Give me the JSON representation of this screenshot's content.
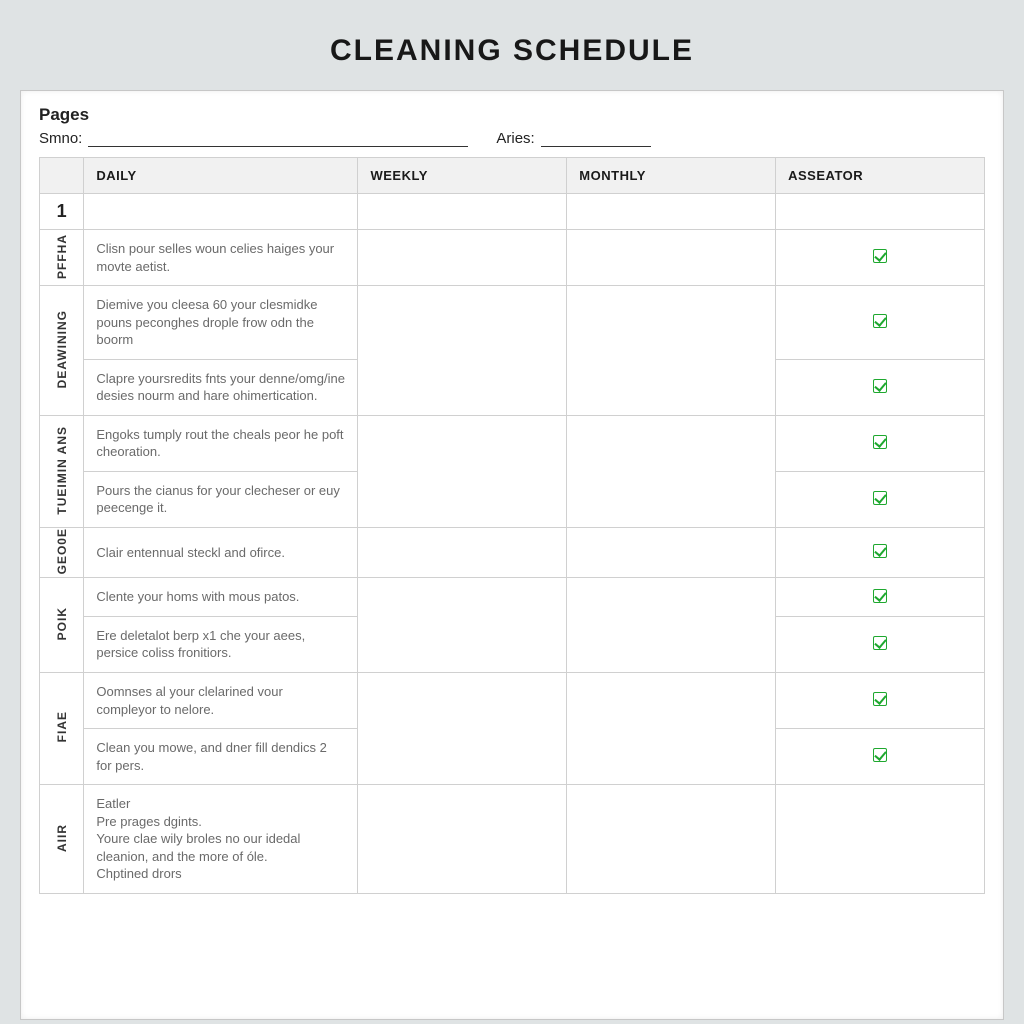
{
  "title": "CLEANING SCHEDULE",
  "header": {
    "pages_label": "Pages",
    "field1_label": "Smno:",
    "field2_label": "Aries:"
  },
  "columns": {
    "side": "",
    "daily": "DAILY",
    "weekly": "WEEKLY",
    "monthly": "MONTHLY",
    "asseator": "ASSEATOR"
  },
  "row_number": "1",
  "sections": [
    {
      "side_label": "PFFHA",
      "tasks": [
        {
          "text": "Clisn pour selles woun celies haiges your movte aetist.",
          "checked": true
        }
      ]
    },
    {
      "side_label": "DEAWINING",
      "tasks": [
        {
          "text": "Diemive you cleesa 60 your clesmidke pouns peconghes drople frow odn the boorm",
          "checked": true
        },
        {
          "text": "Clapre yoursredits fnts your denne/omg/ine desies nourm and hare ohimertication.",
          "checked": true
        }
      ]
    },
    {
      "side_label": "TUEIMIN ANS",
      "tasks": [
        {
          "text": "Engoks tumply rout the cheals peor he poft cheoration.",
          "checked": true
        },
        {
          "text": "Pours the cianus for your clecheser or euy peecenge it.",
          "checked": true
        }
      ]
    },
    {
      "side_label": "GEO0E",
      "tasks": [
        {
          "text": "Clair entennual steckl and ofirce.",
          "checked": true
        }
      ]
    },
    {
      "side_label": "POIK",
      "tasks": [
        {
          "text": "Clente your homs with mous patos.",
          "checked": true
        },
        {
          "text": "Ere deletalot berp x1 che your aees, persice coliss fronitiors.",
          "checked": true
        }
      ]
    },
    {
      "side_label": "FIAE",
      "tasks": [
        {
          "text": "Oomnses al your clelarined vour compleyor to nelore.",
          "checked": true
        },
        {
          "text": "Clean you mowe, and dner fill dendics 2 for pers.",
          "checked": true
        }
      ]
    },
    {
      "side_label": "AIIR",
      "tasks": [
        {
          "text": "Eatler\nPre prages dgints.\nYoure clae wily broles no our idedal cleanion, and the more of óle.\nChptined drors",
          "checked": false
        }
      ]
    }
  ]
}
